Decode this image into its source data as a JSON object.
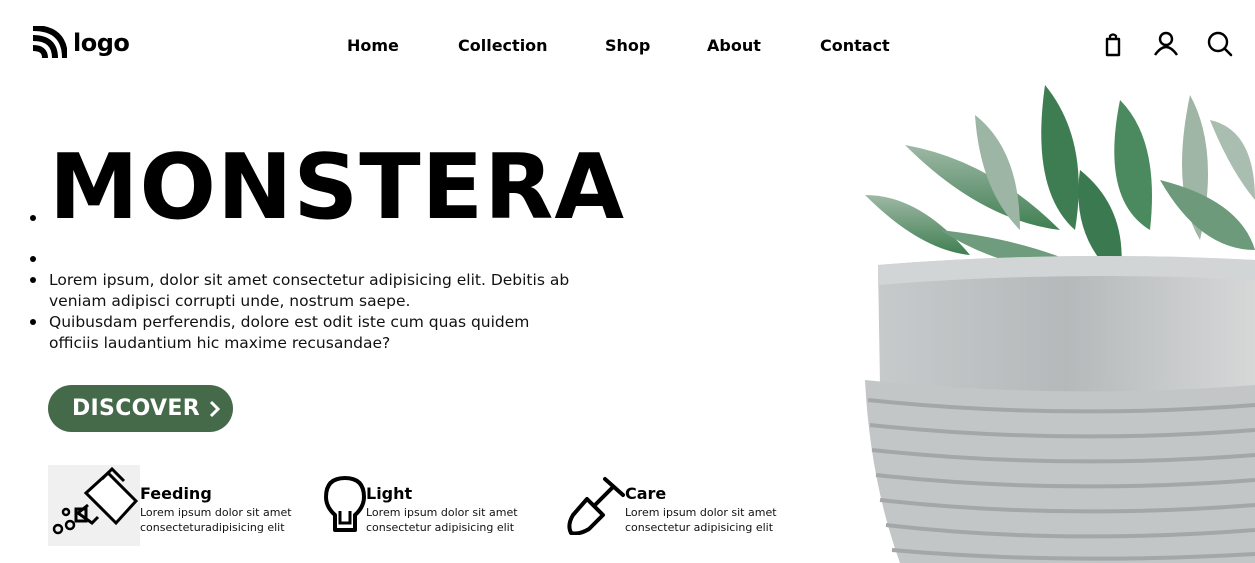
{
  "header": {
    "logo_text": "logo",
    "nav": [
      {
        "label": "Home"
      },
      {
        "label": "Collection"
      },
      {
        "label": "Shop"
      },
      {
        "label": "About"
      },
      {
        "label": "Contact"
      }
    ],
    "icons": [
      "shopping-bag-icon",
      "user-icon",
      "search-icon"
    ]
  },
  "hero": {
    "title": "MONSTERA",
    "paragraphs": [
      "Lorem ipsum, dolor sit amet consectetur adipisicing elit. Debitis ab",
      "veniam adipisci corrupti unde, nostrum saepe.",
      "Quibusdam perferendis, dolore est odit iste cum quas quidem",
      "officiis laudantium hic maxime recusandae?"
    ],
    "cta_label": "DISCOVER",
    "cta_color": "#456a4a"
  },
  "features": [
    {
      "icon": "watering-can-icon",
      "title": "Feeding",
      "line1": "Lorem ipsum dolor sit amet",
      "line2": "consecteturadipisicing elit"
    },
    {
      "icon": "lightbulb-icon",
      "title": "Light",
      "line1": "Lorem ipsum dolor sit amet",
      "line2": "consectetur adipisicing elit"
    },
    {
      "icon": "shovel-icon",
      "title": "Care",
      "line1": "Lorem ipsum dolor sit amet",
      "line2": "consectetur adipisicing elit"
    }
  ]
}
